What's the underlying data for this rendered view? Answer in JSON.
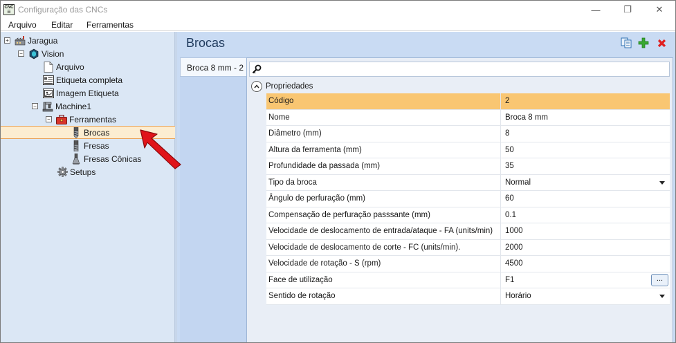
{
  "window": {
    "title": "Configuração das CNCs",
    "icon_text_top": "CNC",
    "icon_text_bottom": "☰",
    "minimize": "—",
    "maximize": "❐",
    "close": "✕"
  },
  "menu": [
    "Arquivo",
    "Editar",
    "Ferramentas"
  ],
  "tree": [
    {
      "label": "Jaragua",
      "toggle": "+",
      "icon": "factory-icon"
    },
    {
      "label": "Vision",
      "toggle": "−",
      "icon": "machine-hex-icon"
    },
    {
      "label": "Arquivo",
      "icon": "file-icon"
    },
    {
      "label": "Etiqueta completa",
      "icon": "label-icon"
    },
    {
      "label": "Imagem Etiqueta",
      "icon": "label-image-icon"
    },
    {
      "label": "Machine1",
      "toggle": "−",
      "icon": "cnc-machine-icon"
    },
    {
      "label": "Ferramentas",
      "toggle": "−",
      "icon": "toolbox-icon"
    },
    {
      "label": "Brocas",
      "icon": "drill-bit-icon",
      "selected": true
    },
    {
      "label": "Fresas",
      "icon": "mill-bit-icon"
    },
    {
      "label": "Fresas Cônicas",
      "icon": "conical-bit-icon"
    },
    {
      "label": "Setups",
      "icon": "gear-icon"
    }
  ],
  "panel": {
    "title": "Brocas",
    "tab": "Broca 8 mm - 2",
    "section": "Propriedades"
  },
  "properties": [
    {
      "name": "Código",
      "value": "2",
      "highlight": true
    },
    {
      "name": "Nome",
      "value": "Broca 8 mm"
    },
    {
      "name": "Diâmetro (mm)",
      "value": "8"
    },
    {
      "name": "Altura da ferramenta (mm)",
      "value": "50"
    },
    {
      "name": "Profundidade da passada (mm)",
      "value": "35"
    },
    {
      "name": "Tipo da broca",
      "value": "Normal",
      "editor": "dropdown"
    },
    {
      "name": "Ângulo de perfuração (mm)",
      "value": "60"
    },
    {
      "name": "Compensação de perfuração passsante (mm)",
      "value": "0.1"
    },
    {
      "name": "Velocidade de deslocamento de entrada/ataque - FA (units/min)",
      "value": "1000"
    },
    {
      "name": "Velocidade de deslocamento de corte - FC (units/min).",
      "value": "2000"
    },
    {
      "name": "Velocidade de rotação - S (rpm)",
      "value": "4500"
    },
    {
      "name": "Face de utilização",
      "value": "F1",
      "editor": "ellipsis",
      "editor_label": "..."
    },
    {
      "name": "Sentido de rotação",
      "value": "Horário",
      "editor": "dropdown"
    }
  ],
  "colors": {
    "tree_bg": "#dbe7f5",
    "panel_bg": "#c9dbf3",
    "selection": "#fcedd1",
    "row_highlight": "#f9c672",
    "title": "#1f3a5c",
    "add_green": "#3aa832",
    "delete_red": "#e02020",
    "annotation_arrow": "#e0141a"
  }
}
